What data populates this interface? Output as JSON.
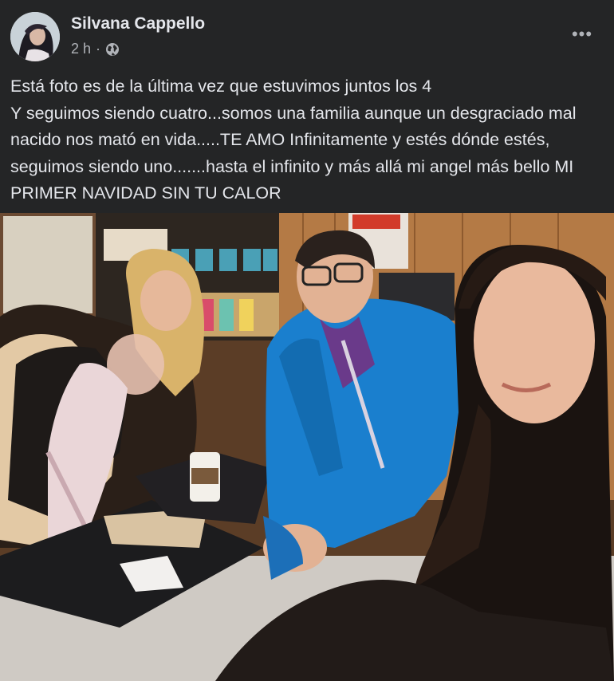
{
  "post": {
    "author": "Silvana Cappello",
    "time": "2 h",
    "separator": "·",
    "audience_icon": "globe-icon",
    "more_icon": "more-options-icon",
    "more_label": "•••",
    "caption_lines": [
      "Está foto es de la última vez que estuvimos juntos los 4",
      "Y seguimos siendo cuatro...somos una familia aunque un desgraciado mal nacido nos mató en vida.....TE AMO Infinitamente y estés dónde estés, seguimos siendo uno.......hasta el infinito y más allá mi angel más bello MI PRIMER NAVIDAD SIN TU CALOR"
    ]
  },
  "colors": {
    "background": "#242526",
    "primary_text": "#e4e6eb",
    "secondary_text": "#b0b3b8"
  }
}
